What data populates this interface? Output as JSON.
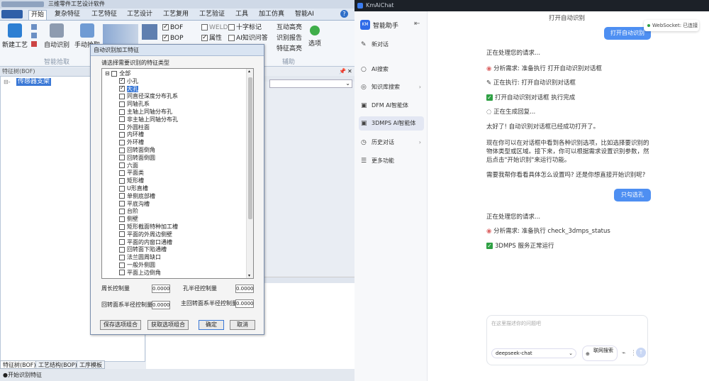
{
  "left_app": {
    "window_title": "三维零件工艺设计软件",
    "menus": [
      "开始",
      "复杂特征",
      "工艺特征",
      "工艺设计",
      "工艺复用",
      "工艺验证",
      "工具",
      "加工仿真",
      "智能AI"
    ],
    "ribbon": {
      "new_process": "新建工艺",
      "auto_recognize": "自动识别",
      "manual_pick": "手动拾取",
      "bof": "BOF",
      "bop": "BOP",
      "weld": "WELD",
      "attribute": "属性",
      "cross_mark": "十字标记",
      "ai_knowledge": "AI知识问答",
      "interactive_highlight": "互动高亮",
      "recog_report": "识别报告",
      "feature_highlight": "特征高亮",
      "options": "选项",
      "group_smart_pick": "智能拾取",
      "group_aux": "辅助"
    },
    "feature_panel_title": "特征树(BOF)",
    "tree_node": "传感器支架",
    "bottom_tabs": [
      "特征树(BOF)",
      "工艺结构(BOP)",
      "工序模板"
    ],
    "status_text": "●开始识别特征"
  },
  "dialog": {
    "title": "自动识别加工特征",
    "prompt": "请选择需要识别的特征类型",
    "items": [
      {
        "label": "全部",
        "checked": false
      },
      {
        "label": "小孔",
        "checked": true
      },
      {
        "label": "大孔",
        "checked": true
      },
      {
        "label": "同直径深度分布孔系",
        "checked": false
      },
      {
        "label": "同轴孔系",
        "checked": false
      },
      {
        "label": "主轴上同轴分布孔",
        "checked": false
      },
      {
        "label": "非主轴上同轴分布孔",
        "checked": false
      },
      {
        "label": "外圆柱面",
        "checked": false
      },
      {
        "label": "内环槽",
        "checked": false
      },
      {
        "label": "外环槽",
        "checked": false
      },
      {
        "label": "回转面倒角",
        "checked": false
      },
      {
        "label": "回转面倒圆",
        "checked": false
      },
      {
        "label": "六面",
        "checked": false
      },
      {
        "label": "平面类",
        "checked": false
      },
      {
        "label": "矩形槽",
        "checked": false
      },
      {
        "label": "U形直槽",
        "checked": false
      },
      {
        "label": "单侧底部槽",
        "checked": false
      },
      {
        "label": "平底沟槽",
        "checked": false
      },
      {
        "label": "台阶",
        "checked": false
      },
      {
        "label": "侧壁",
        "checked": false
      },
      {
        "label": "矩形截面特种加工槽",
        "checked": false
      },
      {
        "label": "平面的外周边侧壁",
        "checked": false
      },
      {
        "label": "平面的内窗口通槽",
        "checked": false
      },
      {
        "label": "回转面下陷通槽",
        "checked": false
      },
      {
        "label": "法兰圆周缺口",
        "checked": false
      },
      {
        "label": "一般外侧圆",
        "checked": false
      },
      {
        "label": "平面上边倒角",
        "checked": false
      }
    ],
    "perimeter_label": "周长控制量",
    "perimeter_value": "0.000000",
    "hole_radius_label": "孔半径控制量",
    "hole_radius_value": "0.000000",
    "rev_radius_label": "回转面系半径控制量",
    "rev_radius_value": "0.000000",
    "main_rev_radius_label": "主回转面系半径控制量",
    "main_rev_radius_value": "0.000000",
    "save_btn": "保存选项组合",
    "load_btn": "获取选项组合",
    "ok_btn": "确定",
    "cancel_btn": "取消"
  },
  "right_app": {
    "window_title": "KmAiChat",
    "brand": "智能助手",
    "brand_logo": "KM",
    "sidebar": [
      {
        "label": "新对话",
        "icon": "✎",
        "chev": ""
      },
      {
        "label": "AI搜索",
        "icon": "○",
        "chev": ""
      },
      {
        "label": "知识库搜索",
        "icon": "◎",
        "chev": "›"
      },
      {
        "label": "DFM AI智能体",
        "icon": "▣",
        "chev": ""
      },
      {
        "label": "3DMPS AI智能体",
        "icon": "▣",
        "chev": ""
      },
      {
        "label": "历史对话",
        "icon": "◷",
        "chev": "›"
      },
      {
        "label": "更多功能",
        "icon": "☰",
        "chev": ""
      }
    ],
    "websocket": "WebSocket: 已连接",
    "chat_header": "打开自动识别",
    "user_msg1": "打开自动识别",
    "processing1": "正在处理您的请求...",
    "step1": "分析需求: 准备执行 打开自动识别对话框",
    "step2": "正在执行: 打开自动识别对话框",
    "step3": "打开自动识别对话框 执行完成",
    "step4": "正在生成回复...",
    "reply1": "太好了!  自动识别对话框已经成功打开了。",
    "reply2a": "现在你可以在对话框中看到各种识别选项，比如选择要识别的",
    "reply2b": "物体类型或区域。接下来，你可以根据需求设置识别参数，然",
    "reply2c": "后点击\"开始识别\"来运行功能。",
    "reply3": "需要我帮你看看具体怎么设置吗? 还是你想直接开始识别呢?",
    "user_msg2": "只勾选孔",
    "processing2": "正在处理您的请求...",
    "step5": "分析需求: 准备执行 check_3dmps_status",
    "step6": "3DMPS 服务正常运行",
    "input_placeholder": "在这里描述你的问题吧",
    "model": "deepseek-chat",
    "web_search": "联网搜索"
  }
}
